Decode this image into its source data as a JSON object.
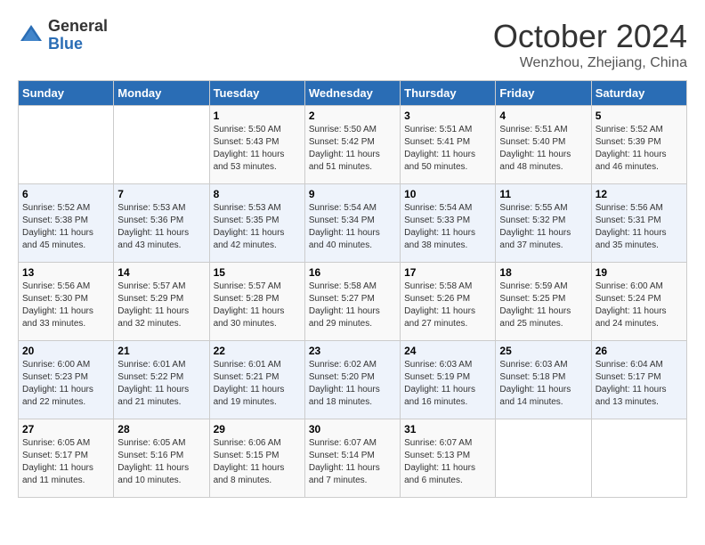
{
  "logo": {
    "text_general": "General",
    "text_blue": "Blue"
  },
  "header": {
    "month": "October 2024",
    "location": "Wenzhou, Zhejiang, China"
  },
  "weekdays": [
    "Sunday",
    "Monday",
    "Tuesday",
    "Wednesday",
    "Thursday",
    "Friday",
    "Saturday"
  ],
  "weeks": [
    [
      {
        "day": "",
        "info": ""
      },
      {
        "day": "",
        "info": ""
      },
      {
        "day": "1",
        "info": "Sunrise: 5:50 AM\nSunset: 5:43 PM\nDaylight: 11 hours and 53 minutes."
      },
      {
        "day": "2",
        "info": "Sunrise: 5:50 AM\nSunset: 5:42 PM\nDaylight: 11 hours and 51 minutes."
      },
      {
        "day": "3",
        "info": "Sunrise: 5:51 AM\nSunset: 5:41 PM\nDaylight: 11 hours and 50 minutes."
      },
      {
        "day": "4",
        "info": "Sunrise: 5:51 AM\nSunset: 5:40 PM\nDaylight: 11 hours and 48 minutes."
      },
      {
        "day": "5",
        "info": "Sunrise: 5:52 AM\nSunset: 5:39 PM\nDaylight: 11 hours and 46 minutes."
      }
    ],
    [
      {
        "day": "6",
        "info": "Sunrise: 5:52 AM\nSunset: 5:38 PM\nDaylight: 11 hours and 45 minutes."
      },
      {
        "day": "7",
        "info": "Sunrise: 5:53 AM\nSunset: 5:36 PM\nDaylight: 11 hours and 43 minutes."
      },
      {
        "day": "8",
        "info": "Sunrise: 5:53 AM\nSunset: 5:35 PM\nDaylight: 11 hours and 42 minutes."
      },
      {
        "day": "9",
        "info": "Sunrise: 5:54 AM\nSunset: 5:34 PM\nDaylight: 11 hours and 40 minutes."
      },
      {
        "day": "10",
        "info": "Sunrise: 5:54 AM\nSunset: 5:33 PM\nDaylight: 11 hours and 38 minutes."
      },
      {
        "day": "11",
        "info": "Sunrise: 5:55 AM\nSunset: 5:32 PM\nDaylight: 11 hours and 37 minutes."
      },
      {
        "day": "12",
        "info": "Sunrise: 5:56 AM\nSunset: 5:31 PM\nDaylight: 11 hours and 35 minutes."
      }
    ],
    [
      {
        "day": "13",
        "info": "Sunrise: 5:56 AM\nSunset: 5:30 PM\nDaylight: 11 hours and 33 minutes."
      },
      {
        "day": "14",
        "info": "Sunrise: 5:57 AM\nSunset: 5:29 PM\nDaylight: 11 hours and 32 minutes."
      },
      {
        "day": "15",
        "info": "Sunrise: 5:57 AM\nSunset: 5:28 PM\nDaylight: 11 hours and 30 minutes."
      },
      {
        "day": "16",
        "info": "Sunrise: 5:58 AM\nSunset: 5:27 PM\nDaylight: 11 hours and 29 minutes."
      },
      {
        "day": "17",
        "info": "Sunrise: 5:58 AM\nSunset: 5:26 PM\nDaylight: 11 hours and 27 minutes."
      },
      {
        "day": "18",
        "info": "Sunrise: 5:59 AM\nSunset: 5:25 PM\nDaylight: 11 hours and 25 minutes."
      },
      {
        "day": "19",
        "info": "Sunrise: 6:00 AM\nSunset: 5:24 PM\nDaylight: 11 hours and 24 minutes."
      }
    ],
    [
      {
        "day": "20",
        "info": "Sunrise: 6:00 AM\nSunset: 5:23 PM\nDaylight: 11 hours and 22 minutes."
      },
      {
        "day": "21",
        "info": "Sunrise: 6:01 AM\nSunset: 5:22 PM\nDaylight: 11 hours and 21 minutes."
      },
      {
        "day": "22",
        "info": "Sunrise: 6:01 AM\nSunset: 5:21 PM\nDaylight: 11 hours and 19 minutes."
      },
      {
        "day": "23",
        "info": "Sunrise: 6:02 AM\nSunset: 5:20 PM\nDaylight: 11 hours and 18 minutes."
      },
      {
        "day": "24",
        "info": "Sunrise: 6:03 AM\nSunset: 5:19 PM\nDaylight: 11 hours and 16 minutes."
      },
      {
        "day": "25",
        "info": "Sunrise: 6:03 AM\nSunset: 5:18 PM\nDaylight: 11 hours and 14 minutes."
      },
      {
        "day": "26",
        "info": "Sunrise: 6:04 AM\nSunset: 5:17 PM\nDaylight: 11 hours and 13 minutes."
      }
    ],
    [
      {
        "day": "27",
        "info": "Sunrise: 6:05 AM\nSunset: 5:17 PM\nDaylight: 11 hours and 11 minutes."
      },
      {
        "day": "28",
        "info": "Sunrise: 6:05 AM\nSunset: 5:16 PM\nDaylight: 11 hours and 10 minutes."
      },
      {
        "day": "29",
        "info": "Sunrise: 6:06 AM\nSunset: 5:15 PM\nDaylight: 11 hours and 8 minutes."
      },
      {
        "day": "30",
        "info": "Sunrise: 6:07 AM\nSunset: 5:14 PM\nDaylight: 11 hours and 7 minutes."
      },
      {
        "day": "31",
        "info": "Sunrise: 6:07 AM\nSunset: 5:13 PM\nDaylight: 11 hours and 6 minutes."
      },
      {
        "day": "",
        "info": ""
      },
      {
        "day": "",
        "info": ""
      }
    ]
  ]
}
